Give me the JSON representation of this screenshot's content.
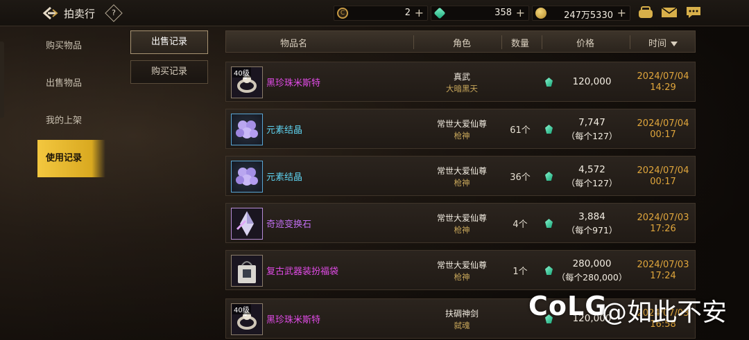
{
  "header": {
    "title": "拍卖行",
    "help": "?",
    "currencies": [
      {
        "icon": "coupon-icon",
        "value": "2"
      },
      {
        "icon": "gem-icon",
        "value": "358"
      },
      {
        "icon": "gold-coin-icon",
        "value": "247万5330"
      }
    ]
  },
  "left_menu": [
    {
      "label": "购买物品"
    },
    {
      "label": "出售物品"
    },
    {
      "label": "我的上架"
    },
    {
      "label": "使用记录",
      "active": true
    }
  ],
  "sub_tabs": {
    "sell_record": "出售记录",
    "buy_record": "购买记录"
  },
  "table": {
    "headers": {
      "name": "物品名",
      "role": "角色",
      "qty": "数量",
      "price": "价格",
      "time": "时间"
    },
    "rows": [
      {
        "level": "40级",
        "name": "黑珍珠米斯特",
        "name_color": "#e04be6",
        "role": "真武",
        "server": "大暗黑天",
        "qty": "",
        "price": "120,000",
        "unit": "",
        "date": "2024/07/04",
        "clock": "14:29",
        "item": "ring"
      },
      {
        "level": "",
        "name": "元素结晶",
        "name_color": "#5fd3f0",
        "role": "常世大爱仙尊",
        "server": "枪神",
        "qty": "61个",
        "price": "7,747",
        "unit": "（每个127）",
        "date": "2024/07/04",
        "clock": "00:17",
        "item": "crystal"
      },
      {
        "level": "",
        "name": "元素结晶",
        "name_color": "#5fd3f0",
        "role": "常世大爱仙尊",
        "server": "枪神",
        "qty": "36个",
        "price": "4,572",
        "unit": "（每个127）",
        "date": "2024/07/04",
        "clock": "00:17",
        "item": "crystal"
      },
      {
        "level": "",
        "name": "奇迹变换石",
        "name_color": "#c06ef0",
        "role": "常世大爱仙尊",
        "server": "枪神",
        "qty": "4个",
        "price": "3,884",
        "unit": "（每个971）",
        "date": "2024/07/03",
        "clock": "17:26",
        "item": "stone"
      },
      {
        "level": "",
        "name": "复古武器装扮福袋",
        "name_color": "#e04be6",
        "role": "常世大爱仙尊",
        "server": "枪神",
        "qty": "1个",
        "price": "280,000",
        "unit": "（每个280,000）",
        "date": "2024/07/03",
        "clock": "17:24",
        "item": "bag"
      },
      {
        "level": "40级",
        "name": "黑珍珠米斯特",
        "name_color": "#e04be6",
        "role": "扶碉神剑",
        "server": "弑魂",
        "qty": "",
        "price": "120,000",
        "unit": "",
        "date": "2024/07/03",
        "clock": "16:58",
        "item": "ring"
      }
    ]
  },
  "watermark": {
    "brand": "CoLG",
    "handle": "@如此不安"
  }
}
